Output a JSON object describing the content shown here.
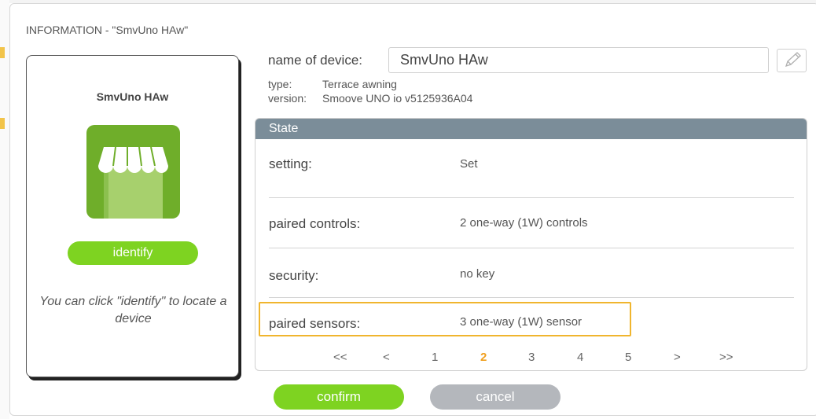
{
  "dialog": {
    "title": "INFORMATION - \"SmvUno HAw\""
  },
  "device_card": {
    "name": "SmvUno HAw",
    "icon": "terrace-awning-icon",
    "identify_label": "identify",
    "hint": "You can click \"identify\" to locate a device"
  },
  "details": {
    "name_label": "name of device:",
    "name_value": "SmvUno HAw",
    "edit_icon": "pencil-icon",
    "type_key": "type:",
    "type_value": "Terrace awning",
    "version_key": "version:",
    "version_value": "Smoove UNO io v5125936A04"
  },
  "state": {
    "header": "State",
    "rows": [
      {
        "key": "setting:",
        "value": "Set"
      },
      {
        "key": "paired controls:",
        "value": "2 one-way (1W) controls"
      },
      {
        "key": "security:",
        "value": "no key"
      },
      {
        "key": "paired sensors:",
        "value": "3 one-way (1W) sensor"
      }
    ],
    "highlighted_row": "paired sensors:"
  },
  "pager": {
    "first": "<<",
    "prev": "<",
    "pages": [
      "1",
      "2",
      "3",
      "4",
      "5"
    ],
    "current": "2",
    "next": ">",
    "last": ">>"
  },
  "actions": {
    "confirm": "confirm",
    "cancel": "cancel"
  },
  "colors": {
    "accent_green": "#7ed321",
    "header_gray": "#7b8d99",
    "highlight": "#f0b52e",
    "cancel_gray": "#b4b7bc"
  }
}
